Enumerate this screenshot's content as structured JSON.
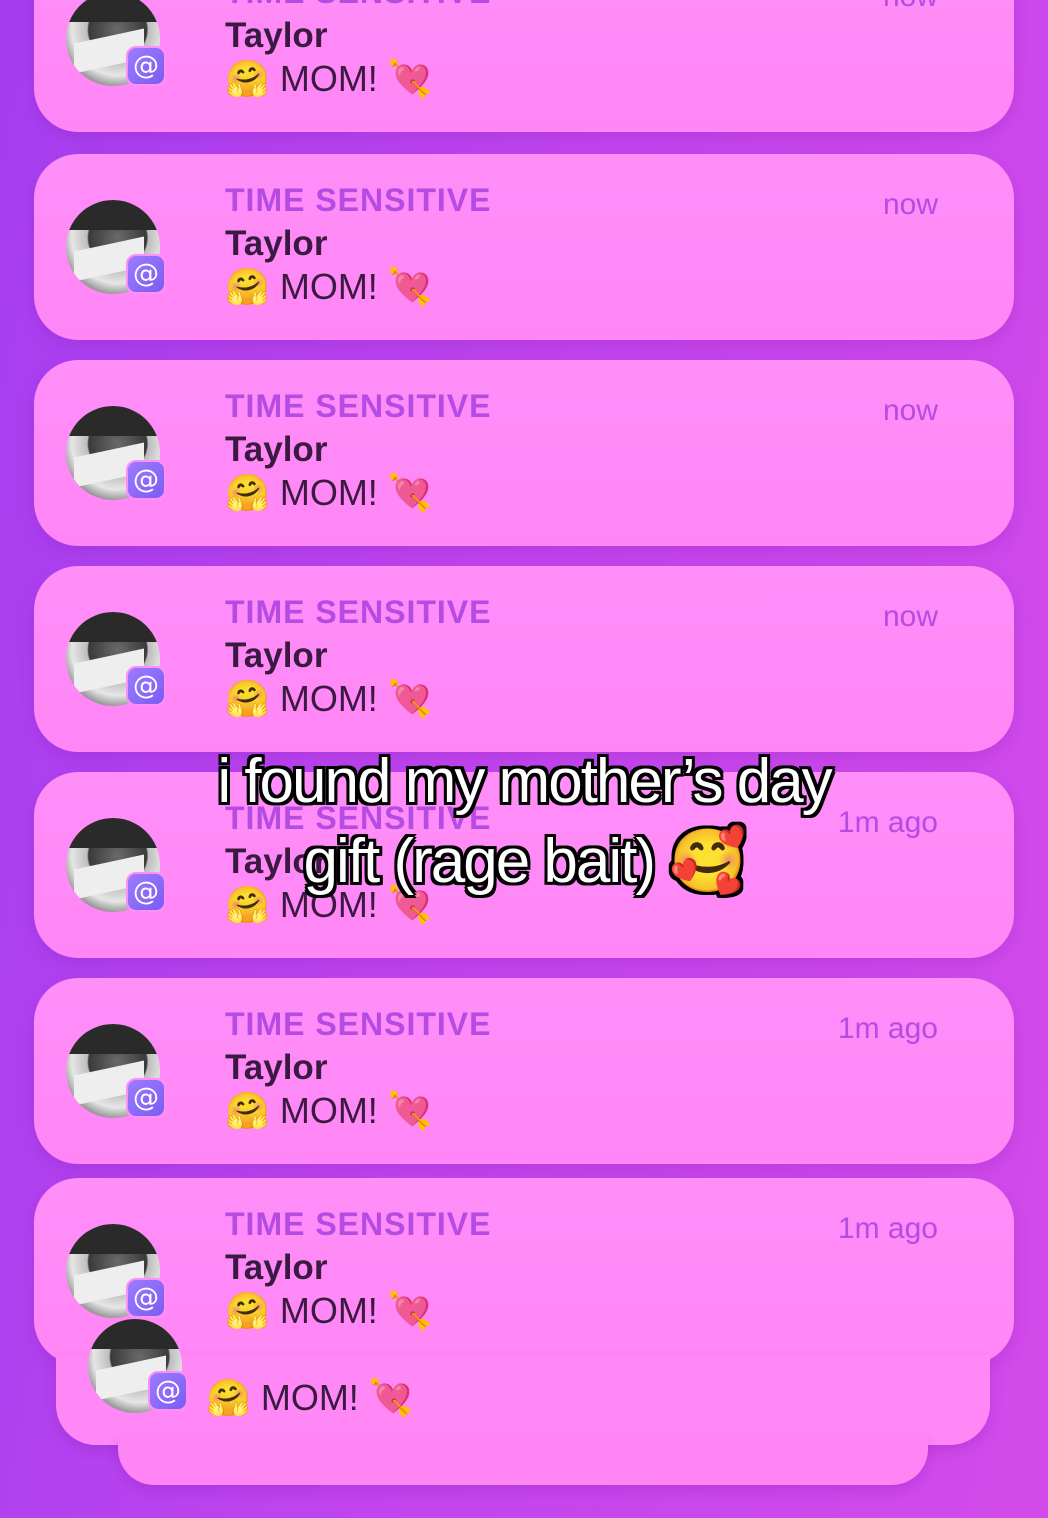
{
  "notifications": [
    {
      "label": "TIME SENSITIVE",
      "sender": "Taylor",
      "message": "🤗 MOM! 💘",
      "time": "now"
    },
    {
      "label": "TIME SENSITIVE",
      "sender": "Taylor",
      "message": "🤗 MOM! 💘",
      "time": "now"
    },
    {
      "label": "TIME SENSITIVE",
      "sender": "Taylor",
      "message": "🤗 MOM! 💘",
      "time": "now"
    },
    {
      "label": "TIME SENSITIVE",
      "sender": "Taylor",
      "message": "🤗 MOM! 💘",
      "time": "now"
    },
    {
      "label": "TIME SENSITIVE",
      "sender": "Taylor",
      "message": "🤗 MOM! 💘",
      "time": "1m ago"
    },
    {
      "label": "TIME SENSITIVE",
      "sender": "Taylor",
      "message": "🤗 MOM! 💘",
      "time": "1m ago"
    },
    {
      "label": "TIME SENSITIVE",
      "sender": "Taylor",
      "message": "🤗 MOM! 💘",
      "time": "1m ago"
    }
  ],
  "stacked": {
    "message": "🤗 MOM! 💘"
  },
  "caption": {
    "line1": "i found my mother’s day",
    "line2": "gift (rage bait) 🥰"
  },
  "icons": {
    "badge": "threads-at-icon",
    "avatar": "contact-photo"
  }
}
